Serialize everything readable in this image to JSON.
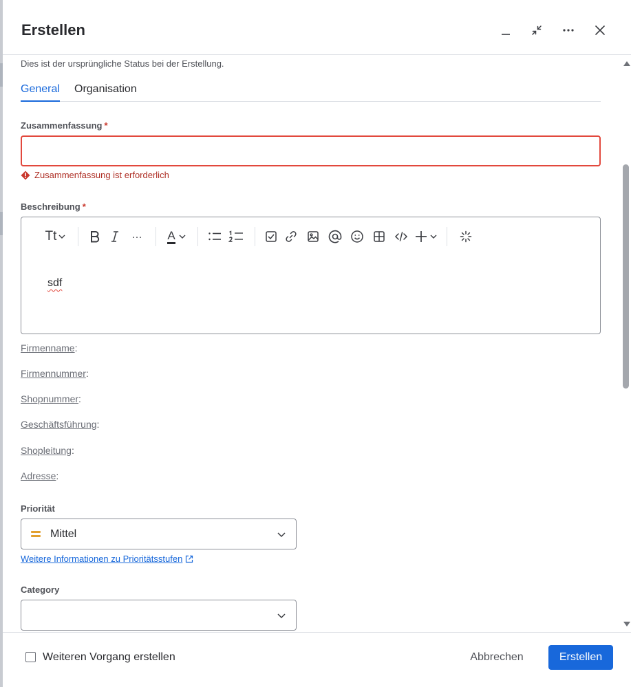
{
  "dialog": {
    "title": "Erstellen"
  },
  "form": {
    "status_helper": "Dies ist der ursprüngliche Status bei der Erstellung.",
    "tabs": [
      {
        "label": "General",
        "active": true
      },
      {
        "label": "Organisation",
        "active": false
      }
    ],
    "summary": {
      "label": "Zusammenfassung",
      "required_mark": "*",
      "value": "",
      "error": "Zusammenfassung ist erforderlich"
    },
    "description": {
      "label": "Beschreibung",
      "required_mark": "*",
      "value": "sdf",
      "toolbar": {
        "text_style": "Tt",
        "more": "···",
        "color_letter": "A"
      }
    },
    "info_fields": [
      {
        "label": "Firmenname",
        "value": ""
      },
      {
        "label": "Firmennummer",
        "value": ""
      },
      {
        "label": "Shopnummer",
        "value": ""
      },
      {
        "label": "Geschäftsführung",
        "value": ""
      },
      {
        "label": "Shopleitung",
        "value": ""
      },
      {
        "label": "Adresse",
        "value": ""
      }
    ],
    "separator": ":",
    "priority": {
      "label": "Priorität",
      "value": "Mittel",
      "icon": "priority-medium-icon",
      "icon_color": "#E2A02F",
      "info_link": "Weitere Informationen zu Prioritätsstufen"
    },
    "category": {
      "label": "Category",
      "value": ""
    }
  },
  "footer": {
    "create_another_label": "Weiteren Vorgang erstellen",
    "create_another_checked": false,
    "cancel_label": "Abbrechen",
    "create_label": "Erstellen"
  },
  "colors": {
    "accent": "#1868DB",
    "error": "#C9372C",
    "error_border": "#E2483D"
  }
}
